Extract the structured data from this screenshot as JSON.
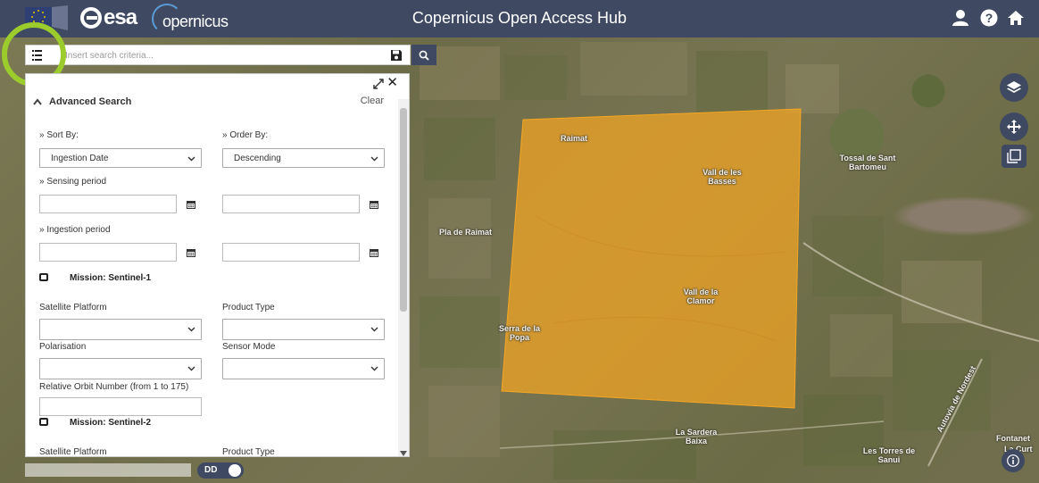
{
  "header": {
    "title": "Copernicus Open Access Hub",
    "logos": {
      "esa": "esa",
      "copernicus": "opernicus"
    },
    "icons": [
      "user-icon",
      "help-icon",
      "home-icon"
    ]
  },
  "search": {
    "placeholder": "Insert search criteria...",
    "value": ""
  },
  "advanced_search": {
    "title": "Advanced Search",
    "clear_label": "Clear",
    "sort_by_label": "» Sort By:",
    "sort_by_value": "Ingestion Date",
    "order_by_label": "» Order By:",
    "order_by_value": "Descending",
    "sensing_period_label": "» Sensing period",
    "ingestion_period_label": "» Ingestion period",
    "sentinel1": {
      "label": "Mission: Sentinel-1",
      "satellite_platform_label": "Satellite Platform",
      "product_type_label": "Product Type",
      "polarisation_label": "Polarisation",
      "sensor_mode_label": "Sensor Mode",
      "relative_orbit_label": "Relative Orbit Number (from 1 to 175)"
    },
    "sentinel2": {
      "label": "Mission: Sentinel-2",
      "satellite_platform_label": "Satellite Platform",
      "product_type_label": "Product Type"
    }
  },
  "map": {
    "labels": {
      "raimat": "Raimat",
      "vall_basses": "Vall de les Basses",
      "pla_raimat": "Pla de Raimat",
      "vall_clamor": "Vall de la Clamor",
      "serra_popa": "Serra de la Popa",
      "sardera": "La Sardera Baixa",
      "tossal": "Tossal de Sant Bartomeu",
      "torres": "Les Torres de Sanui",
      "autovia": "Autovía de Nordest",
      "fontanet": "Fontanet",
      "curt": "La Curt"
    },
    "footprint_color": "#f5a623"
  },
  "footer": {
    "coord_toggle_label": "DD"
  },
  "colors": {
    "header_bg": "#3f4a62",
    "highlight_ring": "#9ccc2c"
  }
}
